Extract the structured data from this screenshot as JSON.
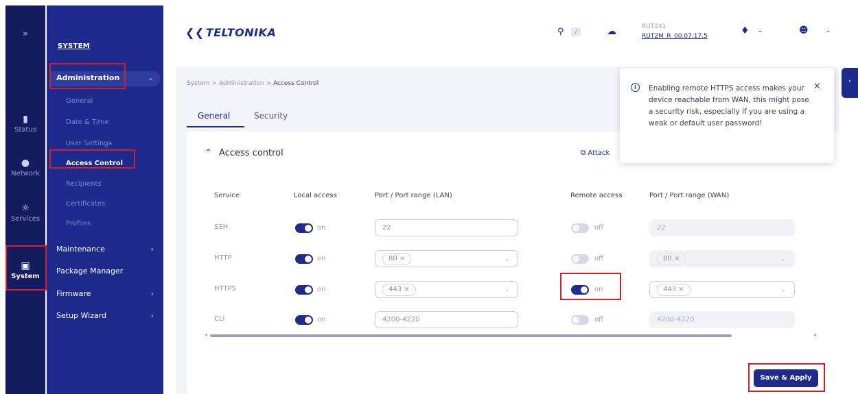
{
  "rail": {
    "toggle": "»",
    "items": [
      {
        "label": "Status",
        "icon": "signal-icon"
      },
      {
        "label": "Network",
        "icon": "globe-icon"
      },
      {
        "label": "Services",
        "icon": "gear-icon"
      },
      {
        "label": "System",
        "icon": "device-icon"
      }
    ]
  },
  "sidebar": {
    "heading": "SYSTEM",
    "administration": "Administration",
    "sub_items": [
      "General",
      "Date & Time",
      "User Settings",
      "Access Control",
      "Recipients",
      "Certificates",
      "Profiles"
    ],
    "items": [
      "Maintenance",
      "Package Manager",
      "Firmware",
      "Setup Wizard"
    ]
  },
  "header": {
    "logo": "TELTONIKA",
    "search_hint": "/",
    "device_name": "RUT241",
    "firmware": "RUT2M_R_00.07.17.5"
  },
  "breadcrumb": {
    "root": "System",
    "parent": "Administration",
    "current": "Access Control",
    "separator": ">"
  },
  "tabs": [
    "General",
    "Security"
  ],
  "section": {
    "title": "Access control",
    "attach_label": "Attack"
  },
  "table": {
    "headers": [
      "Service",
      "Local access",
      "Port / Port range (LAN)",
      "Remote access",
      "Port / Port range (WAN)"
    ],
    "rows": [
      {
        "service": "SSH",
        "local": "on",
        "lan": "22",
        "remote": "off",
        "wan": "22"
      },
      {
        "service": "HTTP",
        "local": "on",
        "lan": "80 ×",
        "remote": "off",
        "wan": "80 ×"
      },
      {
        "service": "HTTPS",
        "local": "on",
        "lan": "443 ×",
        "remote": "on",
        "wan": "443 ×"
      },
      {
        "service": "CLI",
        "local": "on",
        "lan": "4200-4220",
        "remote": "off",
        "wan": "4200-4220"
      }
    ]
  },
  "save_label": "Save & Apply",
  "toast": {
    "message": "Enabling remote HTTPS access makes your device reachable from WAN, this might pose a security risk, especially if you are using a weak or default user password!",
    "close": "✕",
    "info": "i"
  },
  "colors": {
    "brand": "#1e2a8c",
    "rail": "#141b5e",
    "highlight": "#d0202a"
  }
}
